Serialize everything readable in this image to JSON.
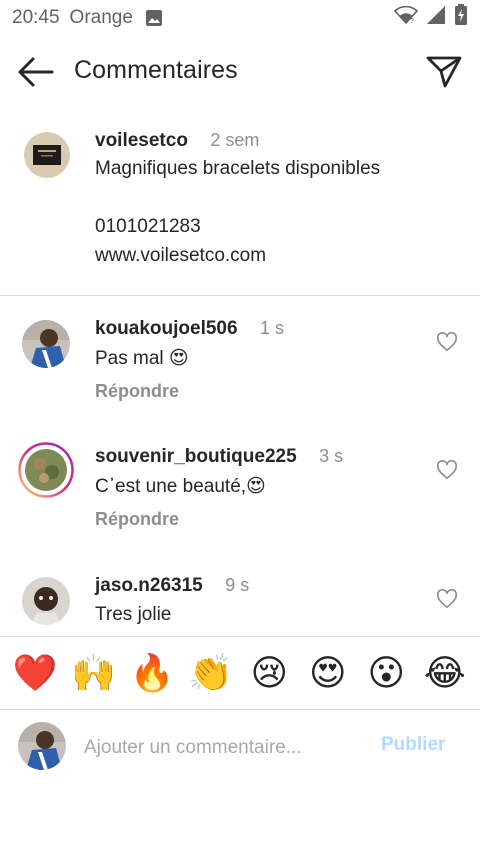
{
  "status_bar": {
    "time": "20:45",
    "carrier": "Orange",
    "icons": [
      "image-icon",
      "wifi-icon",
      "signal-icon",
      "battery-charging-icon"
    ]
  },
  "header": {
    "title": "Commentaires",
    "back_icon": "back-arrow-icon",
    "send_icon": "send-icon"
  },
  "caption": {
    "username": "voilesetco",
    "time": "2 sem",
    "lines": [
      "Magnifiques bracelets disponibles",
      "",
      "0101021283",
      "www.voilesetco.com"
    ]
  },
  "comments": [
    {
      "username": "kouakoujoel506",
      "time": "1 s",
      "text": "Pas mal 😍",
      "reply_label": "Répondre"
    },
    {
      "username": "souvenir_boutique225",
      "time": "3 s",
      "text": "C᾽est une beauté,😍",
      "reply_label": "Répondre"
    },
    {
      "username": "jaso.n26315",
      "time": "9 s",
      "text": "Tres jolie"
    }
  ],
  "emoji_bar": [
    "❤️",
    "🙌",
    "🔥",
    "👏",
    "😢",
    "😍",
    "😮",
    "😂"
  ],
  "composer": {
    "placeholder": "Ajouter un commentaire...",
    "publish_label": "Publier"
  },
  "colors": {
    "text": "#262626",
    "secondary": "#8e8e8e",
    "divider": "#dbdbdb",
    "publish_disabled": "#b3dbff",
    "story_ring": [
      "#feda75",
      "#d62976",
      "#962fbf"
    ]
  }
}
